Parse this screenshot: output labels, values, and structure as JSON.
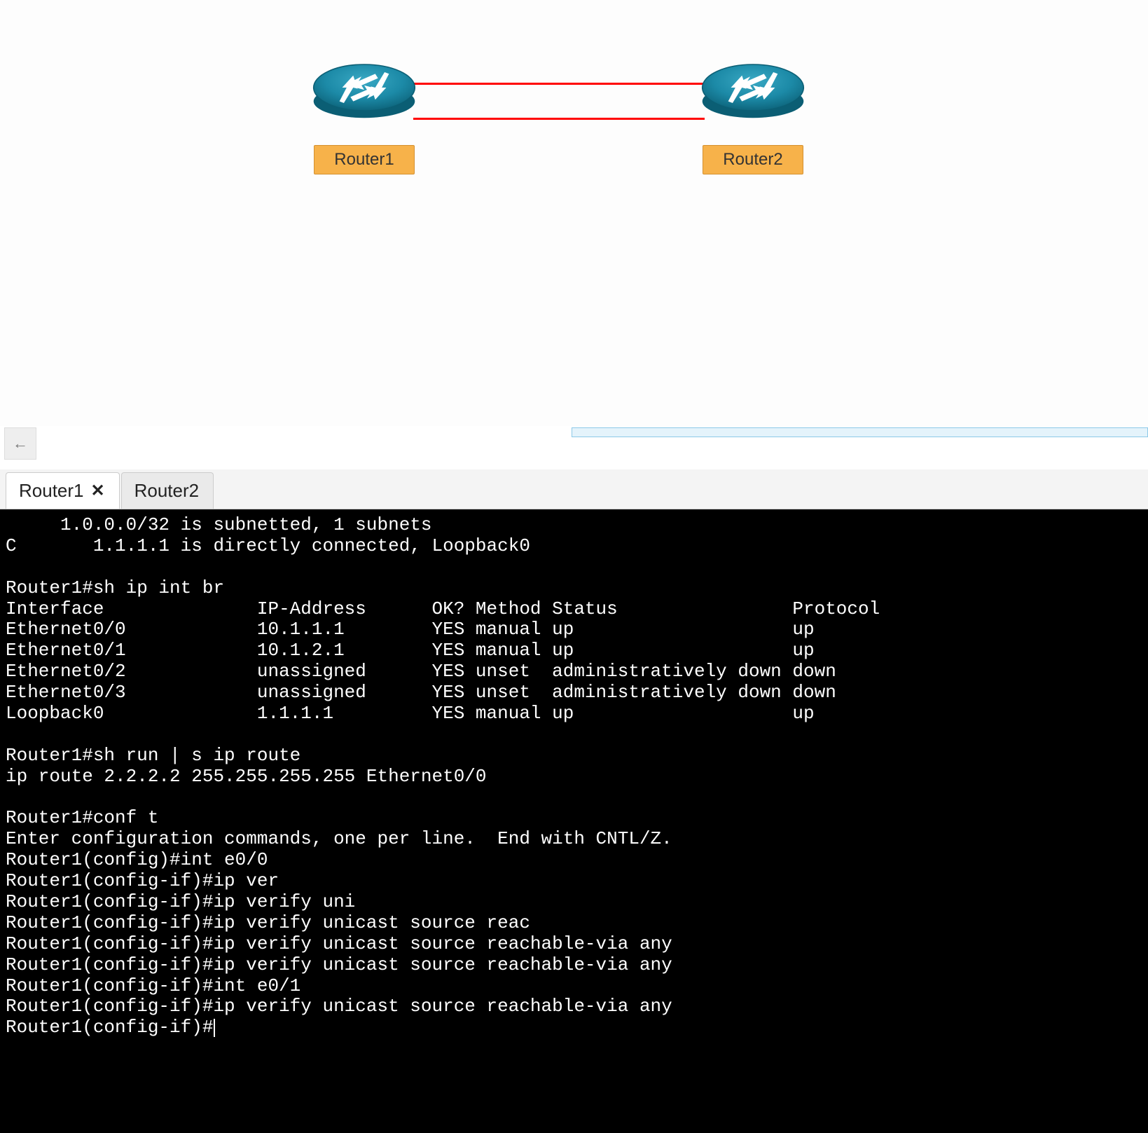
{
  "topology": {
    "router1": {
      "label": "Router1"
    },
    "router2": {
      "label": "Router2"
    }
  },
  "tabs": {
    "active": {
      "label": "Router1",
      "close": "✕"
    },
    "other": {
      "label": "Router2"
    }
  },
  "back_arrow": "←",
  "terminal": {
    "lines": [
      "     1.0.0.0/32 is subnetted, 1 subnets",
      "C       1.1.1.1 is directly connected, Loopback0",
      "",
      "Router1#sh ip int br",
      "Interface              IP-Address      OK? Method Status                Protocol",
      "Ethernet0/0            10.1.1.1        YES manual up                    up",
      "Ethernet0/1            10.1.2.1        YES manual up                    up",
      "Ethernet0/2            unassigned      YES unset  administratively down down",
      "Ethernet0/3            unassigned      YES unset  administratively down down",
      "Loopback0              1.1.1.1         YES manual up                    up",
      "",
      "Router1#sh run | s ip route",
      "ip route 2.2.2.2 255.255.255.255 Ethernet0/0",
      "",
      "Router1#conf t",
      "Enter configuration commands, one per line.  End with CNTL/Z.",
      "Router1(config)#int e0/0",
      "Router1(config-if)#ip ver",
      "Router1(config-if)#ip verify uni",
      "Router1(config-if)#ip verify unicast source reac",
      "Router1(config-if)#ip verify unicast source reachable-via any",
      "Router1(config-if)#ip verify unicast source reachable-via any",
      "Router1(config-if)#int e0/1",
      "Router1(config-if)#ip verify unicast source reachable-via any",
      "Router1(config-if)#"
    ]
  }
}
